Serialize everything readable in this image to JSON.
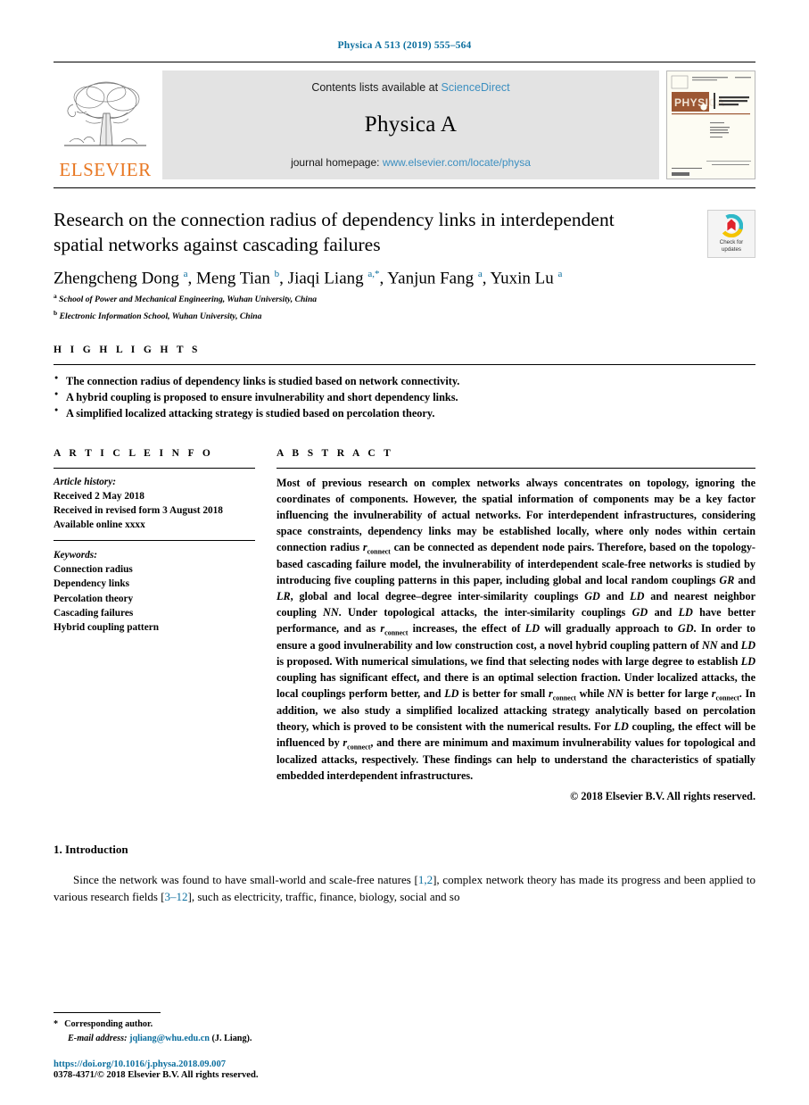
{
  "running_head": "Physica A 513 (2019) 555–564",
  "masthead": {
    "publisher_name": "ELSEVIER",
    "contents_prefix": "Contents lists available at",
    "contents_link": "ScienceDirect",
    "journal_title": "Physica A",
    "homepage_prefix": "journal homepage:",
    "homepage_url": "www.elsevier.com/locate/physa",
    "cover_banner": "PHYSICA",
    "cover_subtitle": "STATISTICAL MECHANICS AND ITS APPLICATIONS"
  },
  "article": {
    "title": "Research on the connection radius of dependency links in interdependent spatial networks against cascading failures",
    "crossmark_label_line1": "Check for",
    "crossmark_label_line2": "updates",
    "authors_html": "Zhengcheng Dong <sup>a</sup>, Meng Tian <sup>b</sup>, Jiaqi Liang <sup>a,*</sup>, Yanjun Fang <sup>a</sup>, Yuxin Lu <sup>a</sup>",
    "affiliations": [
      {
        "marker": "a",
        "text": "School of Power and Mechanical Engineering, Wuhan University, China"
      },
      {
        "marker": "b",
        "text": "Electronic Information School, Wuhan University, China"
      }
    ]
  },
  "highlights": {
    "heading": "H I G H L I G H T S",
    "items": [
      "The connection radius of dependency links is studied based on network connectivity.",
      "A hybrid coupling is proposed to ensure invulnerability and short dependency links.",
      "A simplified localized attacking strategy is studied based on percolation theory."
    ]
  },
  "article_info": {
    "heading": "A R T I C L E    I N F O",
    "history_label": "Article history:",
    "history": [
      "Received 2 May 2018",
      "Received in revised form 3 August 2018",
      "Available online xxxx"
    ],
    "keywords_label": "Keywords:",
    "keywords": [
      "Connection radius",
      "Dependency links",
      "Percolation theory",
      "Cascading failures",
      "Hybrid coupling pattern"
    ]
  },
  "abstract": {
    "heading": "A B S T R A C T",
    "body_html": "Most of previous research on complex networks always concentrates on topology, ignoring the coordinates of components. However, the spatial information of components may be a key factor influencing the invulnerability of actual networks. For interdependent infrastructures, considering space constraints, dependency links may be established locally, where only nodes within certain connection radius <span class=\"it\">r</span><span class=\"sub\">connect</span> can be connected as dependent node pairs. Therefore, based on the topology-based cascading failure model, the invulnerability of interdependent scale-free networks is studied by introducing five coupling patterns in this paper, including global and local random couplings <span class=\"it\">GR</span> and <span class=\"it\">LR</span>, global and local degree–degree inter-similarity couplings <span class=\"it\">GD</span> and <span class=\"it\">LD</span> and nearest neighbor coupling <span class=\"it\">NN</span>. Under topological attacks, the inter-similarity couplings <span class=\"it\">GD</span> and <span class=\"it\">LD</span> have better performance, and as <span class=\"it\">r</span><span class=\"sub\">connect</span> increases, the effect of <span class=\"it\">LD</span> will gradually approach to <span class=\"it\">GD</span>. In order to ensure a good invulnerability and low construction cost, a novel hybrid coupling pattern of <span class=\"it\">NN</span> and <span class=\"it\">LD</span> is proposed. With numerical simulations, we find that selecting nodes with large degree to establish <span class=\"it\">LD</span> coupling has significant effect, and there is an optimal selection fraction. Under localized attacks, the local couplings perform better, and <span class=\"it\">LD</span> is better for small <span class=\"it\">r</span><span class=\"sub\">connect</span> while <span class=\"it\">NN</span> is better for large <span class=\"it\">r</span><span class=\"sub\">connect</span>. In addition, we also study a simplified localized attacking strategy analytically based on percolation theory, which is proved to be consistent with the numerical results. For <span class=\"it\">LD</span> coupling, the effect will be influenced by <span class=\"it\">r</span><span class=\"sub\">connect</span>, and there are minimum and maximum invulnerability values for topological and localized attacks, respectively. These findings can help to understand the characteristics of spatially embedded interdependent infrastructures.",
    "copyright": "© 2018 Elsevier B.V. All rights reserved."
  },
  "introduction": {
    "heading": "1.  Introduction",
    "paragraph_html": "Since the network was found to have small-world and scale-free natures [<span class=\"ref\">1,2</span>], complex network theory has made its progress and been applied to various research fields [<span class=\"ref\">3–12</span>], such as electricity, traffic, finance, biology, social and so"
  },
  "footer": {
    "corresponding_marker": "*",
    "corresponding_text": "Corresponding author.",
    "email_label": "E-mail address:",
    "email": "jqliang@whu.edu.cn",
    "email_suffix": "(J. Liang).",
    "doi": "https://doi.org/10.1016/j.physa.2018.09.007",
    "issn_line": "0378-4371/© 2018 Elsevier B.V. All rights reserved."
  },
  "colors": {
    "link_blue": "#0b6e9e",
    "sciencedirect_blue": "#3c8fc0",
    "elsevier_orange": "#E87722",
    "band_grey": "#e3e3e3",
    "cover_rust": "#9c5733"
  }
}
